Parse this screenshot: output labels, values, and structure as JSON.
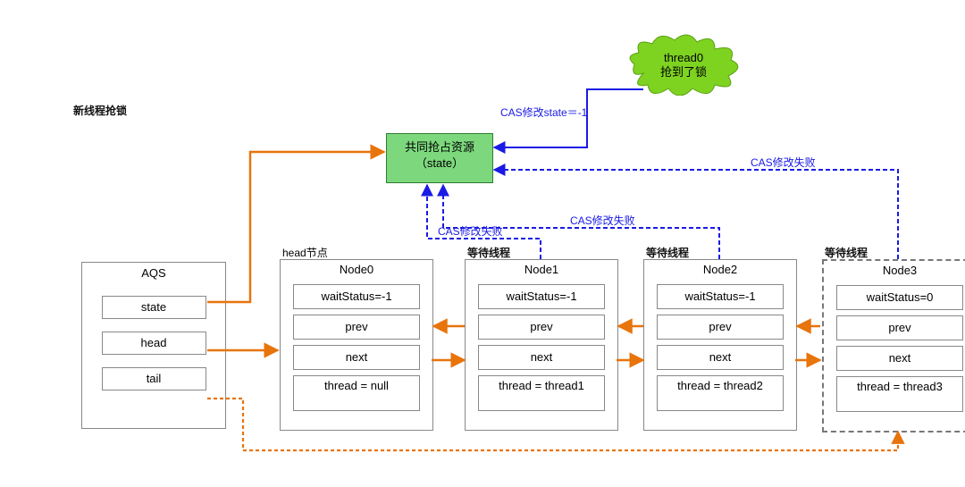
{
  "title": "新线程抢锁",
  "aqs": {
    "title": "AQS",
    "state": "state",
    "head": "head",
    "tail": "tail"
  },
  "labels": {
    "n0": "head节点",
    "n1": "等待线程",
    "n2": "等待线程",
    "n3": "等待线程"
  },
  "nodes": [
    {
      "title": "Node0",
      "ws": "waitStatus=-1",
      "prev": "prev",
      "next": "next",
      "th": "thread = null"
    },
    {
      "title": "Node1",
      "ws": "waitStatus=-1",
      "prev": "prev",
      "next": "next",
      "th": "thread = thread1"
    },
    {
      "title": "Node2",
      "ws": "waitStatus=-1",
      "prev": "prev",
      "next": "next",
      "th": "thread = thread2"
    },
    {
      "title": "Node3",
      "ws": "waitStatus=0",
      "prev": "prev",
      "next": "next",
      "th": "thread = thread3"
    }
  ],
  "resource": "共同抢占资源\n（state）",
  "cloud": "thread0\n抢到了锁",
  "edges": {
    "cas_ok": "CAS修改state＝-1",
    "cas_fail": "CAS修改失败"
  }
}
